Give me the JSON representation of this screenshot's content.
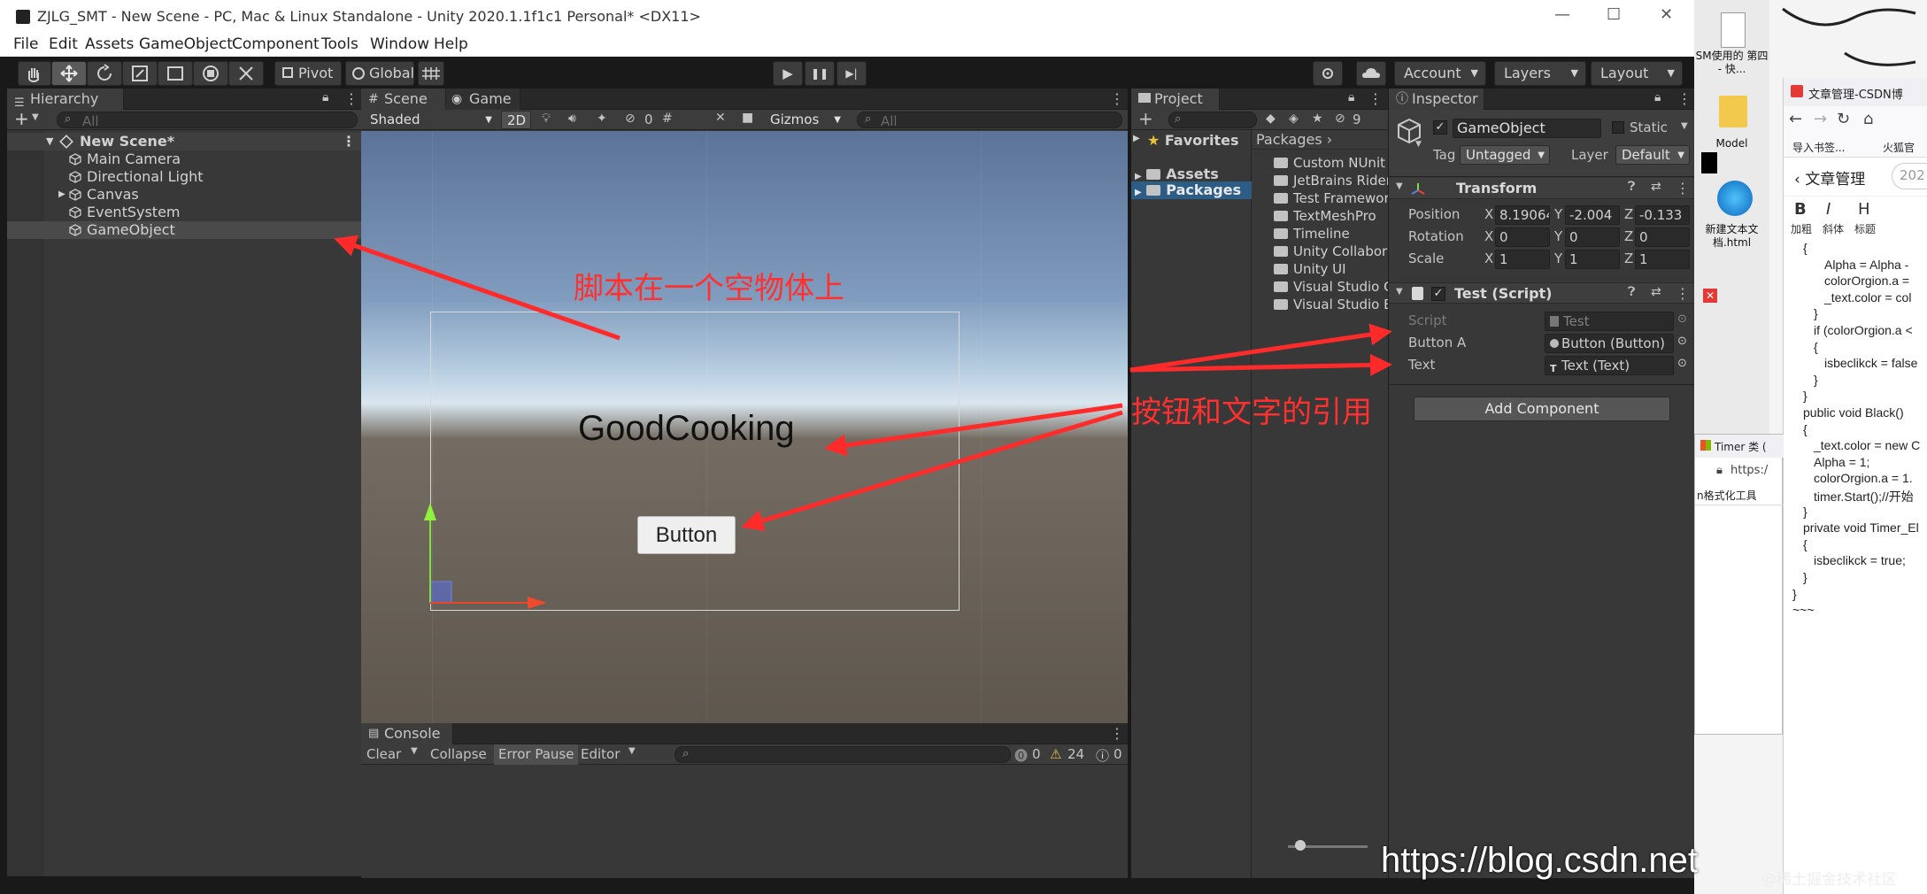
{
  "window": {
    "title": "ZJLG_SMT - New Scene - PC, Mac & Linux Standalone - Unity 2020.1.1f1c1 Personal* <DX11>",
    "min_glyph": "—",
    "max_glyph": "☐",
    "close_glyph": "✕"
  },
  "menu": [
    "File",
    "Edit",
    "Assets",
    "GameObject",
    "Component",
    "Tools",
    "Window",
    "Help"
  ],
  "toolbar": {
    "pivot_label": "Pivot",
    "global_label": "Global",
    "account_label": "Account",
    "layers_label": "Layers",
    "layout_label": "Layout",
    "play_glyph": "▶",
    "pause_glyph": "❚❚",
    "step_glyph": "▶|"
  },
  "hierarchy": {
    "tab_label": "Hierarchy",
    "search_placeholder": "All",
    "add_label": "+",
    "scene_name": "New Scene*",
    "items": [
      {
        "label": "Main Camera",
        "indent": 1
      },
      {
        "label": "Directional Light",
        "indent": 1
      },
      {
        "label": "Canvas",
        "indent": 1,
        "collapsed": true
      },
      {
        "label": "EventSystem",
        "indent": 1
      },
      {
        "label": "GameObject",
        "indent": 1,
        "selected": true
      }
    ]
  },
  "scene": {
    "tabs": [
      "Scene",
      "Game"
    ],
    "shading_mode": "Shaded",
    "mode_2d": "2D",
    "hidden_count": "0",
    "gizmos_label": "Gizmos",
    "search_placeholder": "All",
    "scene_text": "GoodCooking",
    "scene_button": "Button"
  },
  "annotations": {
    "script_note": "脚本在一个空物体上",
    "reference_note": "按钮和文字的引用",
    "arrow_color": "#ff2b2b"
  },
  "project": {
    "tab_label": "Project",
    "hidden_count": "9",
    "favorites_label": "Favorites",
    "tree": [
      "Assets",
      "Packages"
    ],
    "breadcrumb": "Packages",
    "packages": [
      "Custom NUnit",
      "JetBrains Rider",
      "Test Framewor",
      "TextMeshPro",
      "Timeline",
      "Unity Collabora",
      "Unity UI",
      "Visual Studio C",
      "Visual Studio E"
    ]
  },
  "inspector": {
    "tab_label": "Inspector",
    "object_name": "GameObject",
    "static_label": "Static",
    "tag_label": "Tag",
    "tag_value": "Untagged",
    "layer_label": "Layer",
    "layer_value": "Default",
    "transform": {
      "title": "Transform",
      "position": {
        "label": "Position",
        "x": "8.19064",
        "y": "-2.004",
        "z": "-0.133"
      },
      "rotation": {
        "label": "Rotation",
        "x": "0",
        "y": "0",
        "z": "0"
      },
      "scale": {
        "label": "Scale",
        "x": "1",
        "y": "1",
        "z": "1"
      }
    },
    "script_component": {
      "title": "Test (Script)",
      "script_label": "Script",
      "script_value": "Test",
      "button_label": "Button A",
      "button_value": "Button (Button)",
      "text_label": "Text",
      "text_value": "Text (Text)"
    },
    "add_component": "Add Component"
  },
  "console": {
    "tab_label": "Console",
    "clear": "Clear",
    "collapse": "Collapse",
    "error_pause": "Error Pause",
    "editor": "Editor",
    "errors": "0",
    "warnings": "24",
    "infos": "0"
  },
  "desktop": {
    "icons": [
      "SM使用的 第四 - 快...",
      "Model",
      "新建文本文档.html"
    ],
    "browser_tab": "文章管理-CSDN博",
    "bookmarks": [
      "导入书签...",
      "火狐官"
    ],
    "page_title": "文章管理",
    "page_search": "202",
    "editor_tools": [
      "加粗",
      "斜体",
      "标题"
    ],
    "timer_tab": "Timer 类 (",
    "url_prefix": "https:/",
    "json_tool": "n格式化工具",
    "code": [
      "{",
      "Alpha = Alpha -",
      "colorOrgion.a =",
      "_text.color = col",
      "}",
      "if (colorOrgion.a <",
      "{",
      "isbeclikck = false",
      "}",
      "}",
      "public void Black()",
      "{",
      "_text.color = new C",
      "Alpha = 1;",
      "colorOrgion.a = 1.",
      "timer.Start();//开始",
      "}",
      "private void Timer_El",
      "{",
      "isbeclikck = true;",
      "}",
      "}",
      "~~~"
    ]
  },
  "watermark": "https://blog.csdn.net",
  "watermark2": "@稀土掘金技术社区"
}
